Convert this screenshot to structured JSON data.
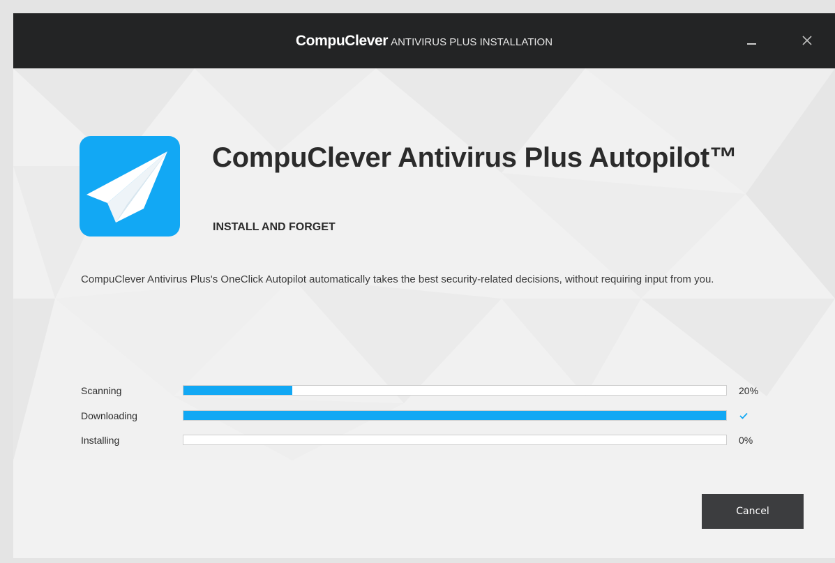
{
  "window": {
    "title_brand": "CompuClever",
    "title_rest": "ANTIVIRUS PLUS INSTALLATION",
    "controls": [
      "minimize-icon",
      "close-icon"
    ]
  },
  "product": {
    "icon": "paper-plane-icon",
    "heading": "CompuClever Antivirus Plus Autopilot™",
    "tagline": "INSTALL AND FORGET",
    "description": "CompuClever Antivirus Plus's OneClick Autopilot automatically takes the best security-related decisions, without requiring input from you."
  },
  "progress": [
    {
      "label": "Scanning",
      "value": 0.2,
      "status": "20%",
      "done": false
    },
    {
      "label": "Downloading",
      "value": 1.0,
      "status": "",
      "done": true,
      "status_icon": "check-icon"
    },
    {
      "label": "Installing",
      "value": 0.0,
      "status": "0%",
      "done": false
    }
  ],
  "footer": {
    "cancel_label": "Cancel"
  },
  "colors": {
    "accent": "#12a8f4",
    "titlebar": "#232425",
    "button": "#3c3d3f"
  }
}
